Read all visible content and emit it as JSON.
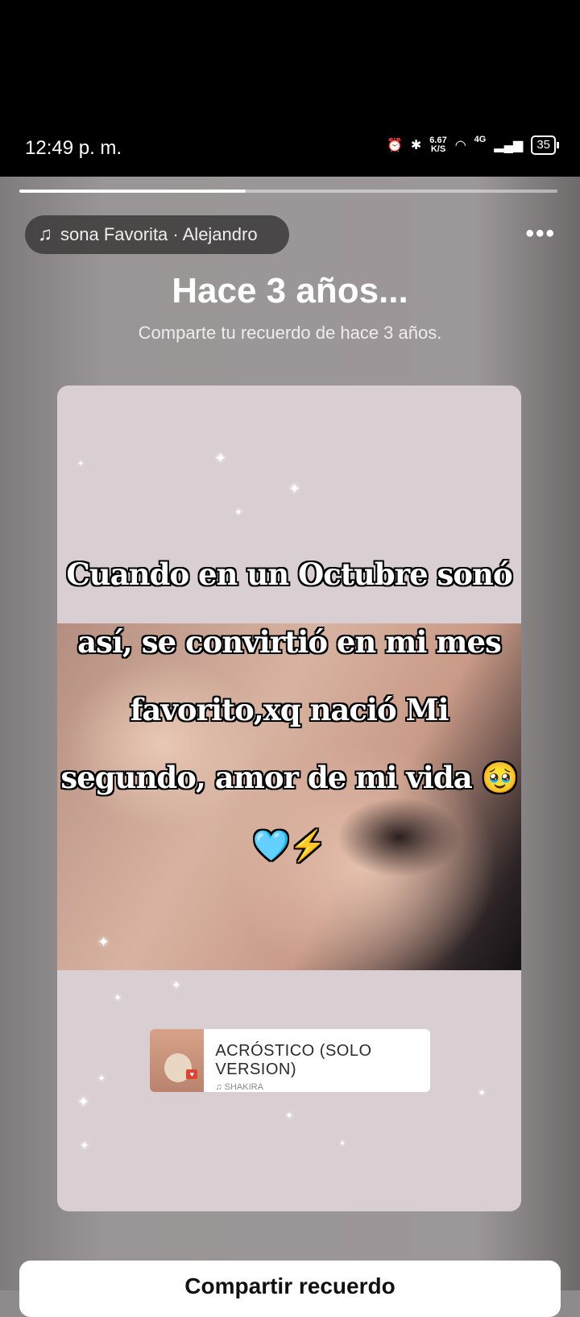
{
  "status_bar": {
    "time": "12:49 p. m.",
    "speed_value": "6.67",
    "speed_unit": "K/S",
    "network": "4G",
    "battery": "35"
  },
  "story": {
    "progress": 0.42,
    "music_pill": "sona Favorita · Alejandro",
    "title": "Hace 3 años...",
    "subtitle": "Comparte tu recuerdo de hace 3 años.",
    "caption": "Cuando en un Octubre sonó así, se convirtió en mi mes favorito,xq nació Mi segundo, amor de mi vida 🥹🩵⚡",
    "song_title": "ACRÓSTICO (SOLO VERSION)",
    "song_artist": "SHAKIRA"
  },
  "actions": {
    "share_label": "Compartir recuerdo"
  }
}
